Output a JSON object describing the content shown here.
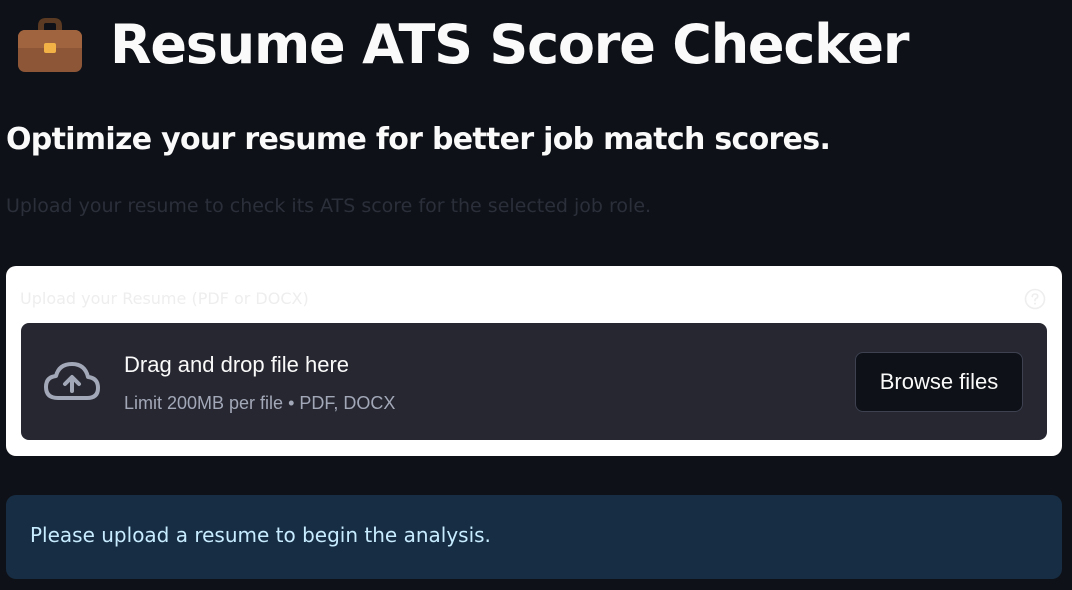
{
  "header": {
    "icon": "briefcase-icon",
    "title": "Resume ATS Score Checker"
  },
  "subtitle": "Optimize your resume for better job match scores.",
  "hint": "Upload your resume to check its ATS score for the selected job role.",
  "uploader": {
    "label": "Upload your Resume (PDF or DOCX)",
    "help_icon": "help-circle-icon",
    "upload_icon": "cloud-upload-icon",
    "drop_title": "Drag and drop file here",
    "drop_limit": "Limit 200MB per file • PDF, DOCX",
    "browse_label": "Browse files"
  },
  "info": {
    "message": "Please upload a resume to begin the analysis."
  },
  "colors": {
    "background": "#0e1117",
    "dropzone": "#262730",
    "info_bg": "#172d43",
    "info_text": "#c7ebff"
  }
}
